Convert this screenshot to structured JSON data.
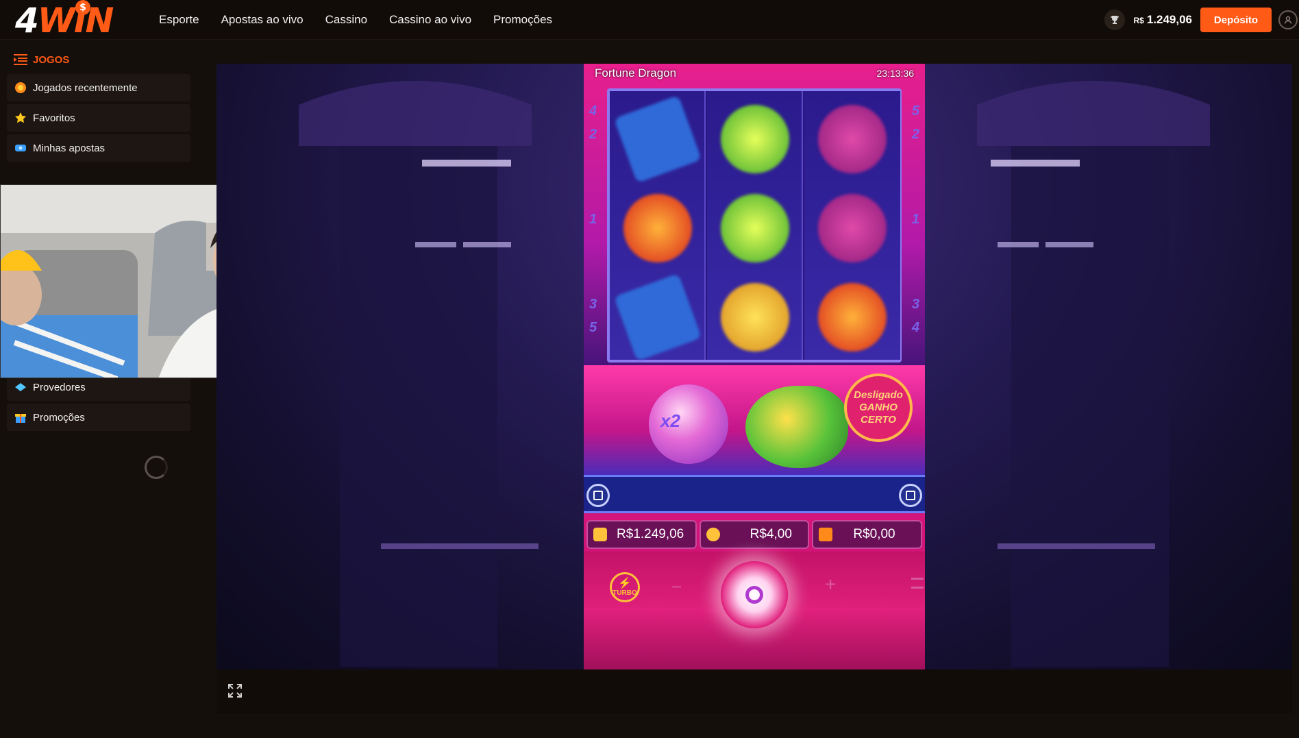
{
  "brand": {
    "name_four": "4",
    "name_win": "WIN",
    "coin_symbol": "$"
  },
  "nav": {
    "items": [
      {
        "label": "Esporte"
      },
      {
        "label": "Apostas ao vivo"
      },
      {
        "label": "Cassino"
      },
      {
        "label": "Cassino ao vivo"
      },
      {
        "label": "Promoções"
      }
    ]
  },
  "header": {
    "currency": "R$",
    "balance": "1.249,06",
    "deposit_label": "Depósito"
  },
  "sidebar": {
    "title": "JOGOS",
    "items": [
      {
        "label": "Jogados recentemente",
        "icon": "history-icon"
      },
      {
        "label": "Favoritos",
        "icon": "star-icon"
      },
      {
        "label": "Minhas apostas",
        "icon": "ticket-icon"
      },
      {
        "label": "Provedores",
        "icon": "provider-icon"
      },
      {
        "label": "Promoções",
        "icon": "gift-icon"
      }
    ]
  },
  "game": {
    "title": "Fortune Dragon",
    "clock": "23:13:36",
    "paylines_left": [
      "4",
      "2",
      "1",
      "3",
      "5"
    ],
    "paylines_right": [
      "5",
      "2",
      "1",
      "3",
      "4"
    ],
    "multiplier": "x2",
    "badge_line1": "Desligado",
    "badge_line2": "GANHO",
    "badge_line3": "CERTO",
    "balance": "R$1.249,06",
    "bet": "R$4,00",
    "win": "R$0,00",
    "turbo_label": "TURBO",
    "minus_label": "−",
    "plus_label": "+"
  },
  "colors": {
    "accent": "#ff5a16",
    "topbar_bg": "#120c09",
    "sidebar_bg": "#150f0c",
    "item_bg": "#1e1612"
  }
}
